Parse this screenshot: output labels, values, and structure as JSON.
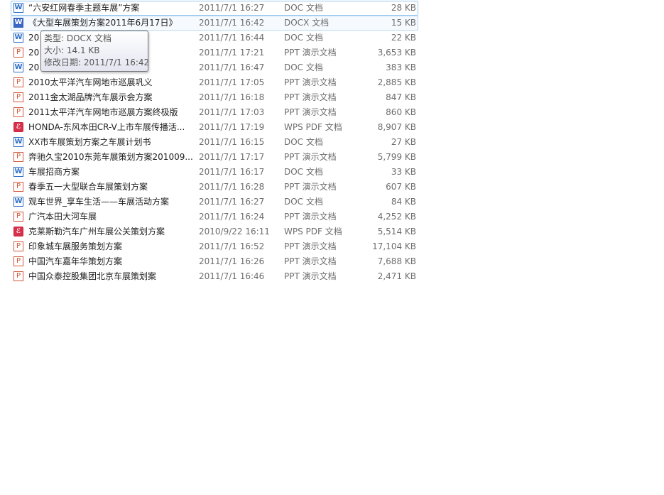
{
  "files": [
    {
      "icon": "doc-icon",
      "glyph": "W",
      "kind": "doc",
      "name": "“六安红网春季主题车展”方案",
      "date": "2011/7/1 16:27",
      "type": "DOC 文档",
      "size": "28 KB"
    },
    {
      "icon": "docx-icon",
      "glyph": "W",
      "kind": "docx",
      "name": "《大型车展策划方案2011年6月17日》",
      "date": "2011/7/1 16:42",
      "type": "DOCX 文档",
      "size": "15 KB"
    },
    {
      "icon": "doc-icon",
      "glyph": "W",
      "kind": "doc",
      "name": "20",
      "date": "2011/7/1 16:44",
      "type": "DOC 文档",
      "size": "22 KB"
    },
    {
      "icon": "ppt-icon",
      "glyph": "P",
      "kind": "ppt",
      "name": "20                                      用PPT)",
      "date": "2011/7/1 17:21",
      "type": "PPT 演示文档",
      "size": "3,653 KB"
    },
    {
      "icon": "doc-icon",
      "glyph": "W",
      "kind": "doc",
      "name": "20                                    大学生...",
      "date": "2011/7/1 16:47",
      "type": "DOC 文档",
      "size": "383 KB"
    },
    {
      "icon": "ppt-icon",
      "glyph": "P",
      "kind": "ppt",
      "name": "2010太平洋汽车网地市巡展巩义",
      "date": "2011/7/1 17:05",
      "type": "PPT 演示文档",
      "size": "2,885 KB"
    },
    {
      "icon": "ppt-icon",
      "glyph": "P",
      "kind": "ppt",
      "name": "2011金太湖品牌汽车展示会方案",
      "date": "2011/7/1 16:18",
      "type": "PPT 演示文档",
      "size": "847 KB"
    },
    {
      "icon": "ppt-icon",
      "glyph": "P",
      "kind": "ppt",
      "name": "2011太平洋汽车网地市巡展方案终极版",
      "date": "2011/7/1 17:03",
      "type": "PPT 演示文档",
      "size": "860 KB"
    },
    {
      "icon": "pdf-icon",
      "glyph": "ℰ",
      "kind": "pdf",
      "name": "HONDA-东风本田CR-V上市车展传播活...",
      "date": "2011/7/1 17:19",
      "type": "WPS PDF 文档",
      "size": "8,907 KB"
    },
    {
      "icon": "doc-icon",
      "glyph": "W",
      "kind": "doc",
      "name": "XX市车展策划方案之车展计划书",
      "date": "2011/7/1 16:15",
      "type": "DOC 文档",
      "size": "27 KB"
    },
    {
      "icon": "ppt-icon",
      "glyph": "P",
      "kind": "ppt",
      "name": "奔驰久宝2010东莞车展策划方案201009...",
      "date": "2011/7/1 17:17",
      "type": "PPT 演示文档",
      "size": "5,799 KB"
    },
    {
      "icon": "doc-icon",
      "glyph": "W",
      "kind": "doc",
      "name": "车展招商方案",
      "date": "2011/7/1 16:17",
      "type": "DOC 文档",
      "size": "33 KB"
    },
    {
      "icon": "ppt-icon",
      "glyph": "P",
      "kind": "ppt",
      "name": "春季五一大型联合车展策划方案",
      "date": "2011/7/1 16:28",
      "type": "PPT 演示文档",
      "size": "607 KB"
    },
    {
      "icon": "doc-icon",
      "glyph": "W",
      "kind": "doc",
      "name": "观车世界_享车生活——车展活动方案",
      "date": "2011/7/1 16:27",
      "type": "DOC 文档",
      "size": "84 KB"
    },
    {
      "icon": "ppt-icon",
      "glyph": "P",
      "kind": "ppt",
      "name": "广汽本田大河车展",
      "date": "2011/7/1 16:24",
      "type": "PPT 演示文档",
      "size": "4,252 KB"
    },
    {
      "icon": "pdf-icon",
      "glyph": "ℰ",
      "kind": "pdf",
      "name": "克莱斯勒汽车广州车展公关策划方案",
      "date": "2010/9/22 16:11",
      "type": "WPS PDF 文档",
      "size": "5,514 KB"
    },
    {
      "icon": "ppt-icon",
      "glyph": "P",
      "kind": "ppt",
      "name": "印象城车展服务策划方案",
      "date": "2011/7/1 16:52",
      "type": "PPT 演示文档",
      "size": "17,104 KB"
    },
    {
      "icon": "ppt-icon",
      "glyph": "P",
      "kind": "ppt",
      "name": "中国汽车嘉年华策划方案",
      "date": "2011/7/1 16:26",
      "type": "PPT 演示文档",
      "size": "7,688 KB"
    },
    {
      "icon": "ppt-icon",
      "glyph": "P",
      "kind": "ppt",
      "name": "中国众泰控股集团北京车展策划案",
      "date": "2011/7/1 16:46",
      "type": "PPT 演示文档",
      "size": "2,471 KB"
    }
  ],
  "tooltip": {
    "type_line": "类型: DOCX 文档",
    "size_line": "大小: 14.1 KB",
    "modified_line": "修改日期: 2011/7/1 16:42"
  }
}
